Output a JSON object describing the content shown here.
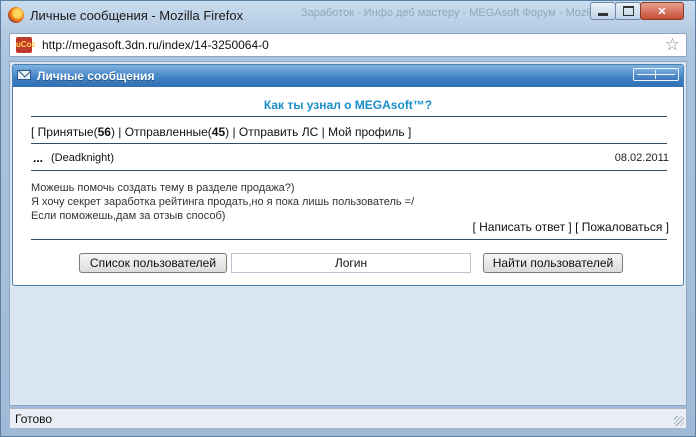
{
  "window": {
    "title": "Личные сообщения - Mozilla Firefox",
    "background_tab_hint": "Заработок - Инфо деб мастеру - MEGAsoft Форум - Mozilla",
    "close_glyph": "✕"
  },
  "address_bar": {
    "url": "http://megasoft.3dn.ru/index/14-3250064-0",
    "site_icon_text": "uCoz",
    "bookmark_glyph": "☆"
  },
  "panel": {
    "title": "Личные сообщения",
    "heading": "Как ты узнал о MEGAsoft™?",
    "nav": {
      "inbox_label": "Принятые",
      "inbox_count": "56",
      "sent_label": "Отправленные",
      "sent_count": "45",
      "send_label": "Отправить ЛС",
      "profile_label": "Мой профиль"
    },
    "message": {
      "dots": "...",
      "author": "(Deadknight)",
      "date": "08.02.2011",
      "lines": [
        "Можешь помочь создать тему в разделе продажа?)",
        "Я хочу секрет заработка рейтинга продать,но я пока лишь пользователь =/",
        "Если поможешь,дам за отзыв способ)"
      ],
      "reply_label": "Написать ответ",
      "complain_label": "Пожаловаться"
    },
    "users_button": "Список пользователей",
    "login_placeholder": "Логин",
    "find_button": "Найти пользователей"
  },
  "status_bar": {
    "text": "Готово"
  },
  "colors": {
    "panel_header": "#3f80c4",
    "heading_link": "#1a8ec9",
    "window_frame": "#b7cde4"
  }
}
